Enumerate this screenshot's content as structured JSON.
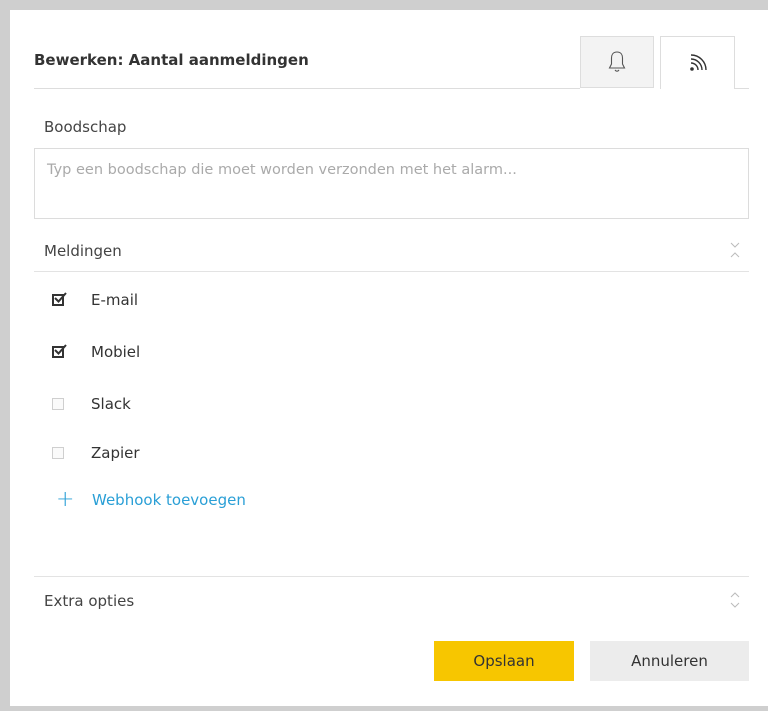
{
  "dialog": {
    "title": "Bewerken: Aantal aanmeldingen",
    "tabs": [
      {
        "icon": "bell-icon"
      },
      {
        "icon": "rss-icon"
      }
    ]
  },
  "message": {
    "label": "Boodschap",
    "placeholder": "Typ een boodschap die moet worden verzonden met het alarm..."
  },
  "notifications": {
    "label": "Meldingen",
    "options": [
      {
        "label": "E-mail",
        "checked": true
      },
      {
        "label": "Mobiel",
        "checked": true
      },
      {
        "label": "Slack",
        "checked": false
      },
      {
        "label": "Zapier",
        "checked": false
      }
    ],
    "add_webhook": "Webhook toevoegen"
  },
  "extra": {
    "label": "Extra opties"
  },
  "buttons": {
    "save": "Opslaan",
    "cancel": "Annuleren"
  },
  "colors": {
    "accent": "#f7c600",
    "link": "#2a9fd6"
  }
}
